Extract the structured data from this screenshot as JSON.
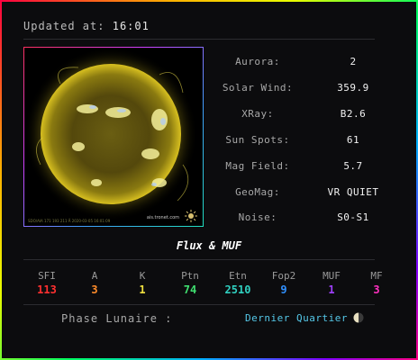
{
  "header": {
    "updated_label": "Updated at:",
    "updated_time": "16:01"
  },
  "sun_image": {
    "caption": "SDO/AIA 171 193 211 Å 2020-03-05 16:01:09",
    "credit": "ais.tronet.com"
  },
  "metrics": [
    {
      "label": "Aurora:",
      "value": "2"
    },
    {
      "label": "Solar Wind:",
      "value": "359.9"
    },
    {
      "label": "XRay:",
      "value": "B2.6"
    },
    {
      "label": "Sun Spots:",
      "value": "61"
    },
    {
      "label": "Mag Field:",
      "value": "5.7"
    },
    {
      "label": "GeoMag:",
      "value": "VR QUIET"
    },
    {
      "label": "Noise:",
      "value": "S0-S1"
    }
  ],
  "flux": {
    "title": "Flux & MUF",
    "items": [
      {
        "label": "SFI",
        "value": "113",
        "color": "#ff3030"
      },
      {
        "label": "A",
        "value": "3",
        "color": "#ff8c2a"
      },
      {
        "label": "K",
        "value": "1",
        "color": "#f0e040"
      },
      {
        "label": "Ptn",
        "value": "74",
        "color": "#40e070"
      },
      {
        "label": "Etn",
        "value": "2510",
        "color": "#30d0c0"
      },
      {
        "label": "Fop2",
        "value": "9",
        "color": "#3090ff"
      },
      {
        "label": "MUF",
        "value": "1",
        "color": "#a040ff"
      },
      {
        "label": "MF",
        "value": "3",
        "color": "#ff30c0"
      }
    ]
  },
  "moon": {
    "label": "Phase Lunaire :",
    "value": "Dernier Quartier"
  },
  "colors": {
    "accent_moon": "#55c8e8",
    "background": "#0c0c0e"
  }
}
